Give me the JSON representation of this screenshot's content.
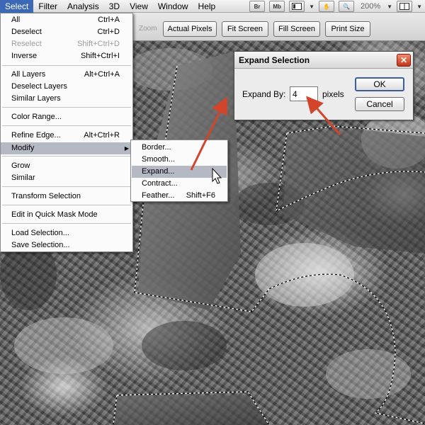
{
  "menubar": {
    "items": [
      "Select",
      "Filter",
      "Analysis",
      "3D",
      "View",
      "Window",
      "Help"
    ],
    "active": "Select",
    "bridge_label": "Br",
    "minibridge_label": "Mb",
    "zoom": "200%"
  },
  "options_bar": {
    "zoom_label": "Zoom",
    "buttons": [
      "Actual Pixels",
      "Fit Screen",
      "Fill Screen",
      "Print Size"
    ]
  },
  "select_menu": {
    "items": [
      {
        "label": "All",
        "shortcut": "Ctrl+A"
      },
      {
        "label": "Deselect",
        "shortcut": "Ctrl+D"
      },
      {
        "label": "Reselect",
        "shortcut": "Shift+Ctrl+D",
        "disabled": true
      },
      {
        "label": "Inverse",
        "shortcut": "Shift+Ctrl+I"
      },
      {
        "label": "All Layers",
        "shortcut": "Alt+Ctrl+A"
      },
      {
        "label": "Deselect Layers",
        "shortcut": ""
      },
      {
        "label": "Similar Layers",
        "shortcut": ""
      },
      {
        "label": "Color Range...",
        "shortcut": ""
      },
      {
        "label": "Refine Edge...",
        "shortcut": "Alt+Ctrl+R"
      },
      {
        "label": "Modify",
        "shortcut": "",
        "submenu": true,
        "highlighted": true
      },
      {
        "label": "Grow",
        "shortcut": ""
      },
      {
        "label": "Similar",
        "shortcut": ""
      },
      {
        "label": "Transform Selection",
        "shortcut": ""
      },
      {
        "label": "Edit in Quick Mask Mode",
        "shortcut": ""
      },
      {
        "label": "Load Selection...",
        "shortcut": ""
      },
      {
        "label": "Save Selection...",
        "shortcut": ""
      }
    ]
  },
  "modify_submenu": {
    "items": [
      {
        "label": "Border...",
        "shortcut": ""
      },
      {
        "label": "Smooth...",
        "shortcut": ""
      },
      {
        "label": "Expand...",
        "shortcut": "",
        "highlighted": true
      },
      {
        "label": "Contract...",
        "shortcut": ""
      },
      {
        "label": "Feather...",
        "shortcut": "Shift+F6"
      }
    ]
  },
  "dialog": {
    "title": "Expand Selection",
    "field_label": "Expand By:",
    "field_value": "4",
    "unit": "pixels",
    "ok_label": "OK",
    "cancel_label": "Cancel",
    "close_glyph": "✕"
  },
  "colors": {
    "menu_highlight": "#3c68b5",
    "item_highlight": "#b5b9c4",
    "annotation_arrow": "#d2452b",
    "close_button": "#c4341a"
  }
}
